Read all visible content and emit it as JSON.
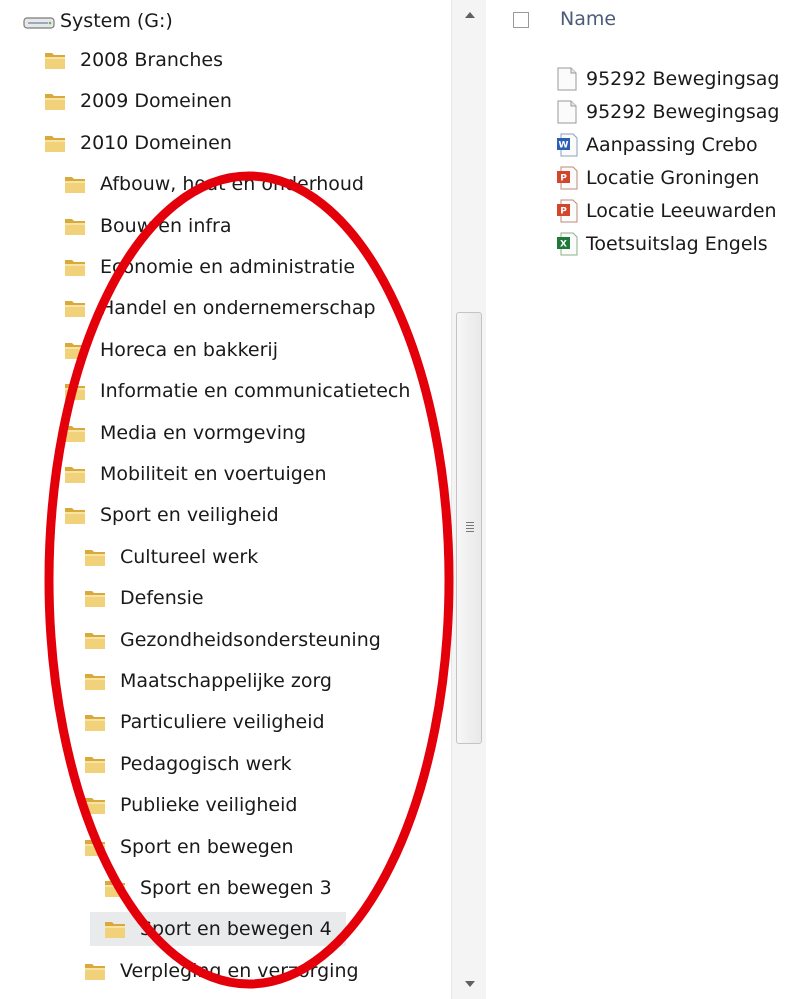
{
  "nav": {
    "drive_label": "System (G:)",
    "items": [
      {
        "label": "2008 Branches",
        "level": 0
      },
      {
        "label": "2009 Domeinen",
        "level": 0
      },
      {
        "label": "2010 Domeinen",
        "level": 0
      },
      {
        "label": "Afbouw, hout en onderhoud",
        "level": 1
      },
      {
        "label": "Bouw en infra",
        "level": 1
      },
      {
        "label": "Economie en administratie",
        "level": 1
      },
      {
        "label": "Handel en ondernemerschap",
        "level": 1
      },
      {
        "label": "Horeca en bakkerij",
        "level": 1
      },
      {
        "label": "Informatie en communicatietech",
        "level": 1
      },
      {
        "label": "Media en vormgeving",
        "level": 1
      },
      {
        "label": "Mobiliteit en voertuigen",
        "level": 1
      },
      {
        "label": "Sport en veiligheid",
        "level": 1
      },
      {
        "label": "Cultureel werk",
        "level": 2
      },
      {
        "label": "Defensie",
        "level": 2
      },
      {
        "label": "Gezondheidsondersteuning",
        "level": 2
      },
      {
        "label": "Maatschappelijke zorg",
        "level": 2
      },
      {
        "label": "Particuliere veiligheid",
        "level": 2
      },
      {
        "label": "Pedagogisch werk",
        "level": 2
      },
      {
        "label": "Publieke veiligheid",
        "level": 2
      },
      {
        "label": "Sport en bewegen",
        "level": 2
      },
      {
        "label": "Sport en bewegen 3",
        "level": 3
      },
      {
        "label": "Sport en bewegen 4",
        "level": 3,
        "selected": true
      },
      {
        "label": "Verpleging en verzorging",
        "level": 2
      }
    ]
  },
  "content": {
    "column_name": "Name",
    "files": [
      {
        "label": "95292 Bewegingsag",
        "icon": "generic-file-icon"
      },
      {
        "label": "95292 Bewegingsag",
        "icon": "generic-file-icon"
      },
      {
        "label": "Aanpassing Crebo",
        "icon": "word-file-icon"
      },
      {
        "label": "Locatie Groningen",
        "icon": "powerpoint-file-icon"
      },
      {
        "label": "Locatie Leeuwarden",
        "icon": "powerpoint-file-icon"
      },
      {
        "label": "Toetsuitslag Engels",
        "icon": "excel-file-icon"
      }
    ]
  },
  "colors": {
    "annotation": "#e4000a",
    "folder": "#e9c86a",
    "selected_bg": "#e9eaec",
    "header_text": "#4c5c78"
  }
}
